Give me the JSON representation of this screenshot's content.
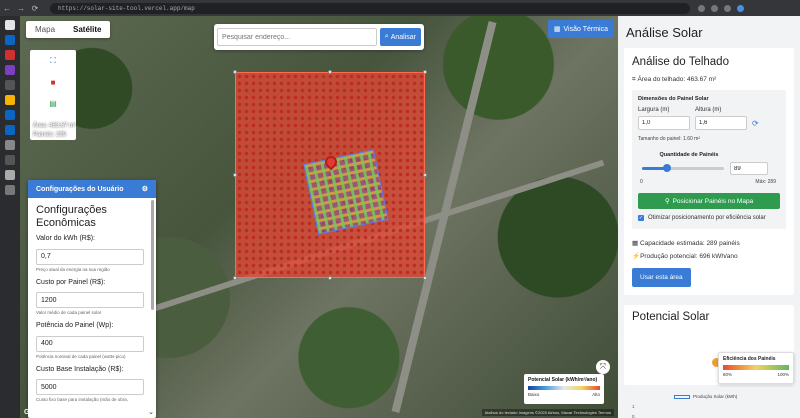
{
  "browser": {
    "url": "https://solar-site-tool.vercel.app/map"
  },
  "map": {
    "tabs": [
      {
        "label": "Mapa",
        "active": false
      },
      {
        "label": "Satélite",
        "active": true
      }
    ],
    "search_placeholder": "Pesquisar endereço...",
    "search_button": "Analisar",
    "thermal_button": "Visão Térmica",
    "area_text": "Área: 463.67 m²",
    "panels_text": "Painéis: 289",
    "legend": {
      "title": "Potencial Solar (kWh/m²/ano)",
      "low": "Baixo",
      "high": "Alto"
    },
    "google_logo": "Google",
    "attribution": "Atalhos do teclado   Imagens ©2025 Airbus, Maxar Technologies   Termos"
  },
  "config": {
    "header": "Configurações do Usuário",
    "title": "Configurações Econômicas",
    "fields": [
      {
        "label": "Valor do kWh (R$):",
        "value": "0,7",
        "help": "Preço atual da energia na sua região"
      },
      {
        "label": "Custo por Painel (R$):",
        "value": "1200",
        "help": "Valor médio de cada painel solar"
      },
      {
        "label": "Potência do Painel (Wp):",
        "value": "400",
        "help": "Potência nominal de cada painel (watts-pico)"
      },
      {
        "label": "Custo Base Instalação (R$):",
        "value": "5000",
        "help": "Custo fixo base para instalação (mão de obra,"
      }
    ]
  },
  "analysis": {
    "title": "Análise Solar",
    "roof_title": "Análise do Telhado",
    "roof_area": "Área do telhado: 463.67 m²",
    "dims_title": "Dimensões do Painel Solar",
    "width_label": "Largura (m)",
    "width_value": "1,0",
    "height_label": "Altura (m)",
    "height_value": "1,6",
    "panel_size": "Tamanho do painel: 1.60 m²",
    "qty_title": "Quantidade de Painéis",
    "qty_value": "89",
    "qty_fraction": 0.308,
    "qty_min": "0",
    "qty_max": "Máx: 289",
    "place_button": "Posicionar Painéis no Mapa",
    "optimize_label": "Otimizar posicionamento por eficiência solar",
    "capacity": "Capacidade estimada: 289 painéis",
    "production": "Produção potencial: 696 kWh/ano",
    "use_area_button": "Usar esta área"
  },
  "potential": {
    "title": "Potencial Solar",
    "efficiency_title": "Eficiência dos Painéis",
    "eff_low": "80%",
    "eff_high": "100%",
    "chart_legend": "Produção Solar (kWh)",
    "y_ticks": [
      "1",
      "0"
    ]
  },
  "colors": {
    "accent": "#3a7bd5",
    "success": "#2e9b4f",
    "overlay": "#e24834"
  }
}
